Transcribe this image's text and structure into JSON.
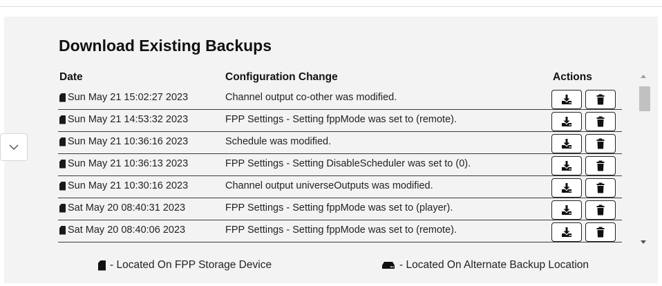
{
  "section": {
    "title": "Download Existing Backups"
  },
  "table": {
    "headers": {
      "date": "Date",
      "change": "Configuration Change",
      "actions": "Actions"
    },
    "rows": [
      {
        "date": "Sun May 21 15:02:27 2023",
        "change": "Channel output co-other was modified.",
        "location_icon": "sd-card-icon"
      },
      {
        "date": "Sun May 21 14:53:32 2023",
        "change": "FPP Settings - Setting fppMode was set to (remote).",
        "location_icon": "sd-card-icon"
      },
      {
        "date": "Sun May 21 10:36:16 2023",
        "change": "Schedule was modified.",
        "location_icon": "sd-card-icon"
      },
      {
        "date": "Sun May 21 10:36:13 2023",
        "change": "FPP Settings - Setting DisableScheduler was set to (0).",
        "location_icon": "sd-card-icon"
      },
      {
        "date": "Sun May 21 10:30:16 2023",
        "change": "Channel output universeOutputs was modified.",
        "location_icon": "sd-card-icon"
      },
      {
        "date": "Sat May 20 08:40:31 2023",
        "change": "FPP Settings - Setting fppMode was set to (player).",
        "location_icon": "sd-card-icon"
      },
      {
        "date": "Sat May 20 08:40:06 2023",
        "change": "FPP Settings - Setting fppMode was set to (remote).",
        "location_icon": "sd-card-icon"
      }
    ],
    "row_actions": [
      "download-icon",
      "trash-icon"
    ]
  },
  "legend": {
    "storage": "- Located On FPP Storage Device",
    "alternate": "- Located On Alternate Backup Location",
    "storage_icon": "sd-card-icon",
    "alternate_icon": "hard-drive-icon"
  },
  "controls": {
    "collapse_icon": "chevron-down-icon"
  }
}
